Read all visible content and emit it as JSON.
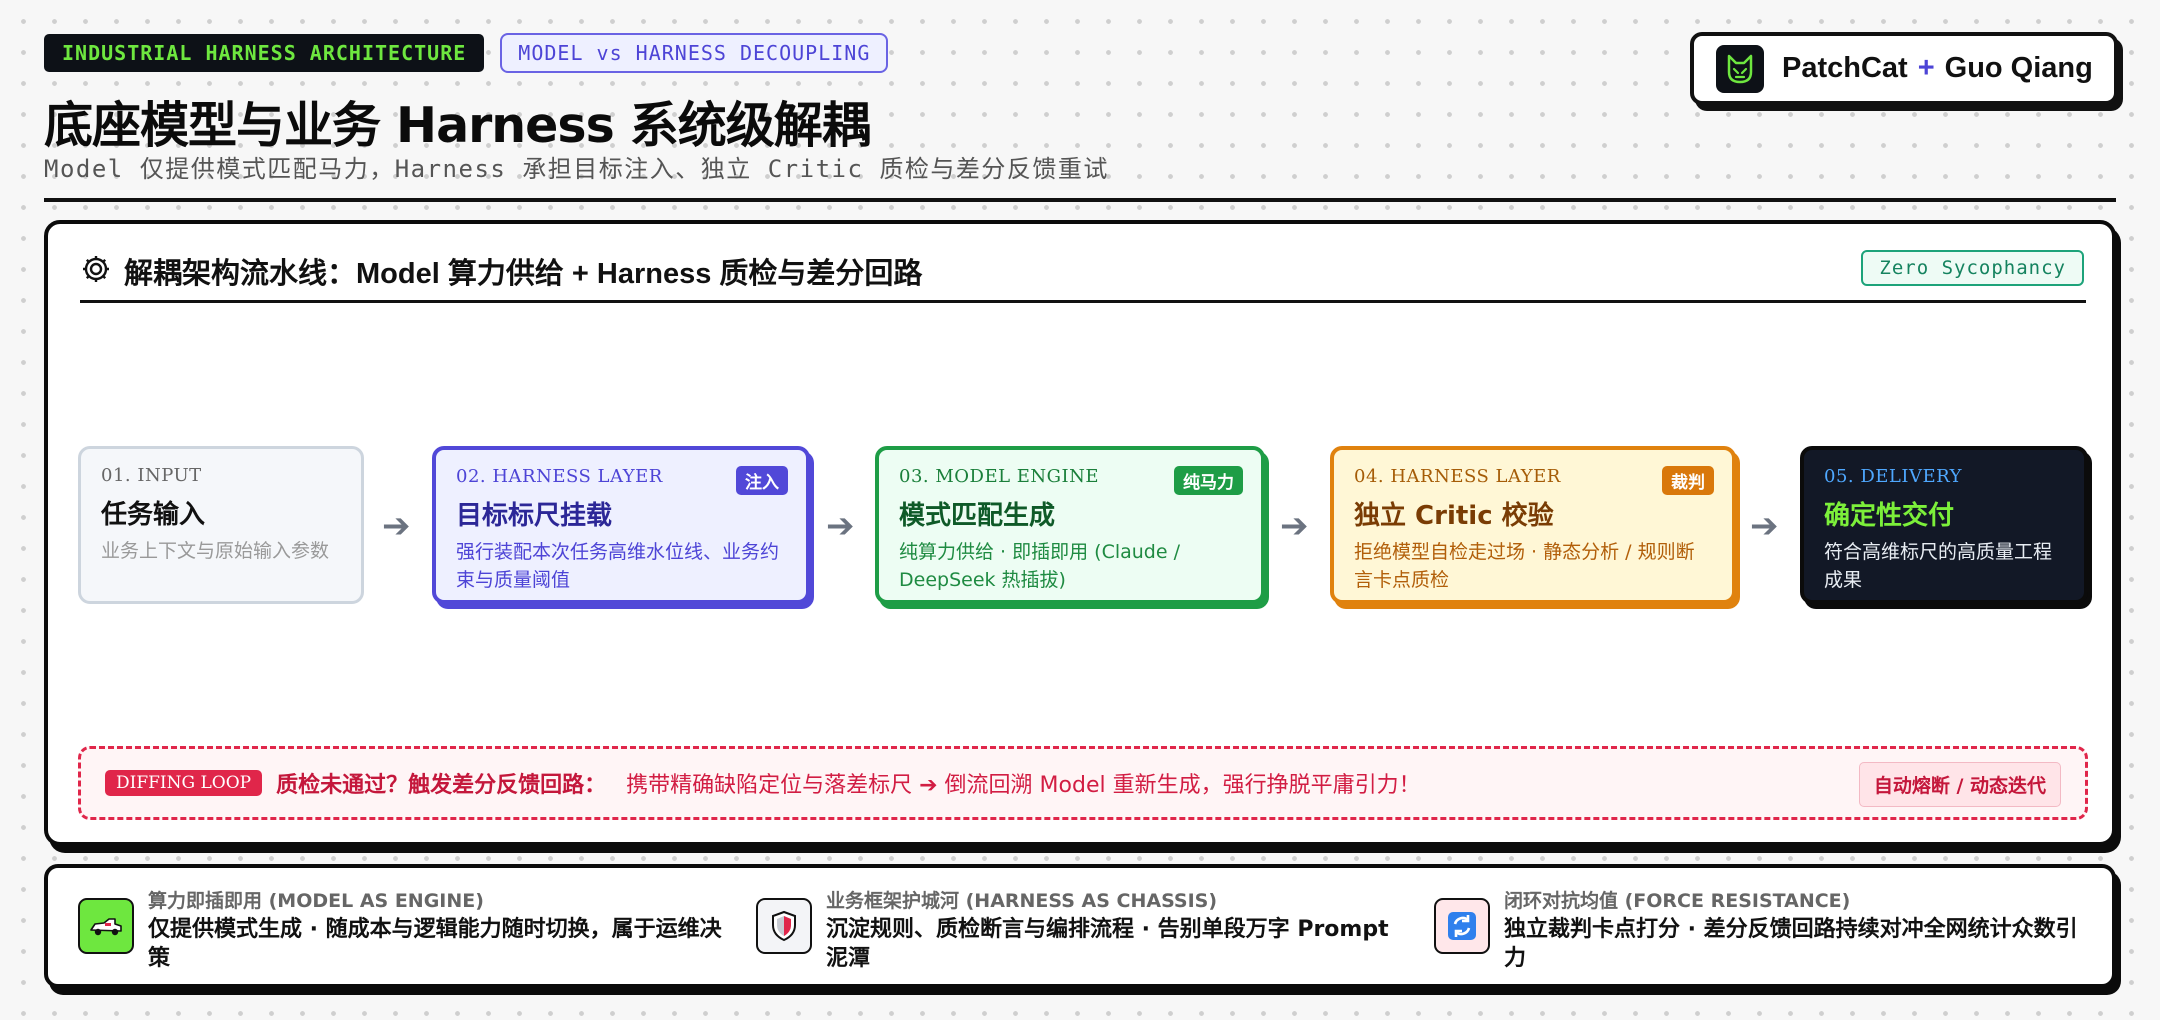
{
  "header": {
    "tag_primary": "INDUSTRIAL HARNESS ARCHITECTURE",
    "tag_secondary": "MODEL vs HARNESS DECOUPLING",
    "title": "底座模型与业务 Harness 系统级解耦",
    "subtitle": "Model 仅提供模式匹配马力，Harness 承担目标注入、独立 Critic 质检与差分反馈重试"
  },
  "brand": {
    "name_left": "PatchCat",
    "plus": "+",
    "name_right": "Guo Qiang",
    "logo_icon": "cat-icon",
    "logo_color": "#6ee73f"
  },
  "panel": {
    "title": "解耦架构流水线：Model 算力供给 + Harness 质检与差分回路",
    "title_icon": "gear-icon",
    "badge": "Zero Sycophancy"
  },
  "stages": [
    {
      "num": "01. INPUT",
      "title": "任务输入",
      "desc": "业务上下文与原始输入参数",
      "badge": ""
    },
    {
      "num": "02. HARNESS LAYER",
      "title": "目标标尺挂载",
      "desc": "强行装配本次任务高维水位线、业务约束与质量阈值",
      "badge": "注入"
    },
    {
      "num": "03. MODEL ENGINE",
      "title": "模式匹配生成",
      "desc": "纯算力供给 · 即插即用 (Claude / DeepSeek 热插拔)",
      "badge": "纯马力"
    },
    {
      "num": "04. HARNESS LAYER",
      "title": "独立 Critic 校验",
      "desc": "拒绝模型自检走过场 · 静态分析 / 规则断言卡点质检",
      "badge": "裁判"
    },
    {
      "num": "05. DELIVERY",
      "title": "确定性交付",
      "desc": "符合高维标尺的高质量工程成果",
      "badge": ""
    }
  ],
  "arrows": [
    "➔",
    "➔",
    "➔",
    "➔"
  ],
  "loop": {
    "tag": "DIFFING LOOP",
    "title": "质检未通过？触发差分反馈回路：",
    "text": "携带精确缺陷定位与落差标尺 ➔ 倒流回溯 Model 重新生成，强行挣脱平庸引力！",
    "right": "自动熔断 / 动态迭代"
  },
  "footer": [
    {
      "sub": "算力即插即用 (MODEL AS ENGINE)",
      "main": "仅提供模式生成 · 随成本与逻辑能力随时切换，属于运维决策",
      "icon": "race-car-icon"
    },
    {
      "sub": "业务框架护城河 (HARNESS AS CHASSIS)",
      "main": "沉淀规则、质检断言与编排流程 · 告别单段万字 Prompt 泥潭",
      "icon": "shield-icon"
    },
    {
      "sub": "闭环对抗均值 (FORCE RESISTANCE)",
      "main": "独立裁判卡点打分 · 差分反馈回路持续对冲全网统计众数引力",
      "icon": "refresh-icon"
    }
  ],
  "colors": {
    "accent_indigo": "#5148d8",
    "accent_green": "#1e9d46",
    "accent_orange": "#e0820e",
    "accent_red": "#e0264a",
    "accent_lime": "#6ee73f",
    "dark": "#121826"
  }
}
